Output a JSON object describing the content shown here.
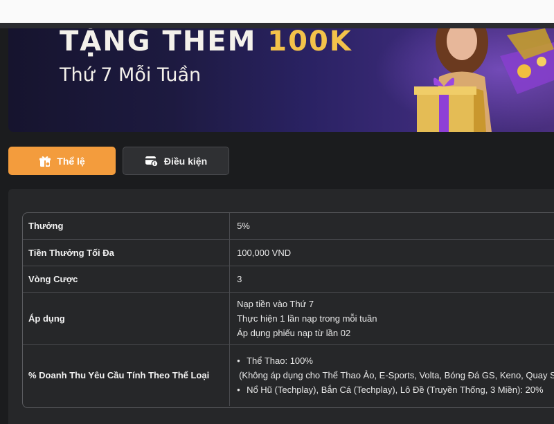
{
  "banner": {
    "title_prefix": "TẶNG THÊM ",
    "title_amount": "100K",
    "subtitle": "Thứ 7 Mỗi Tuần"
  },
  "tabs": [
    {
      "label": "Thể lệ",
      "icon": "gift-box-icon",
      "active": true
    },
    {
      "label": "Điều kiện",
      "icon": "card-info-icon",
      "active": false
    }
  ],
  "colors": {
    "accent": "#f39c3d",
    "background": "#1b1c1e",
    "panel": "#262729",
    "gold": "#f3c24a"
  },
  "table": {
    "rows": [
      {
        "key": "Thưởng",
        "value": "5%"
      },
      {
        "key": "Tiền Thưởng Tối Đa",
        "value": "100,000 VND"
      },
      {
        "key": "Vòng Cược",
        "value": "3"
      },
      {
        "key": "Áp dụng",
        "lines": [
          "Nạp tiền vào Thứ 7",
          "Thực hiện 1 lần nạp trong mỗi tuần",
          "Áp dụng phiếu nạp từ lần 02"
        ]
      },
      {
        "key": "% Doanh Thu Yêu Cầu Tính Theo Thể Loại",
        "bullet1": "Thể Thao: 100%",
        "bullet1_note": "(Không áp dụng cho Thể Thao Ảo, E-Sports, Volta, Bóng Đá GS, Keno, Quay Số",
        "bullet2": "Nổ Hũ (Techplay), Bắn Cá (Techplay), Lô Đề (Truyền Thống, 3 Miền): 20%"
      }
    ]
  }
}
